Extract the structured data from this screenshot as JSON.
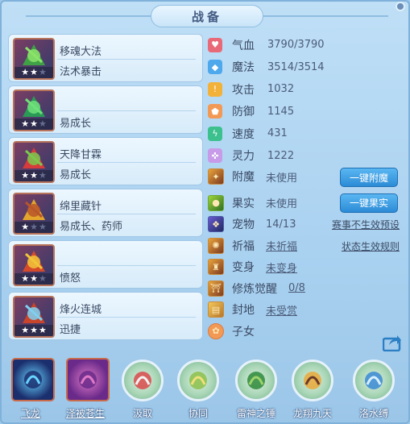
{
  "header": {
    "title": "战备"
  },
  "equipment": [
    {
      "name": "移魂大法",
      "effect": "法术暴击",
      "stars_filled": 2,
      "stars_total": 3,
      "colors": [
        "#3fa046",
        "#8be36a"
      ]
    },
    {
      "name": "",
      "effect": "易成长",
      "stars_filled": 2,
      "stars_total": 3,
      "colors": [
        "#2a9a56",
        "#6ee07a"
      ]
    },
    {
      "name": "天降甘霖",
      "effect": "易成长",
      "stars_filled": 2,
      "stars_total": 3,
      "colors": [
        "#d83b3b",
        "#7bc84e"
      ]
    },
    {
      "name": "绵里藏针",
      "effect": "易成长、药师",
      "stars_filled": 1,
      "stars_total": 3,
      "colors": [
        "#e3a52b",
        "#b8562a"
      ]
    },
    {
      "name": "",
      "effect": "愤怒",
      "stars_filled": 2,
      "stars_total": 3,
      "colors": [
        "#d44a2a",
        "#f1c43a"
      ]
    },
    {
      "name": "烽火连城",
      "effect": "迅捷",
      "stars_filled": 3,
      "stars_total": 3,
      "colors": [
        "#c8442a",
        "#7fd0f0"
      ]
    }
  ],
  "stats": [
    {
      "label": "气血",
      "value": "3790/3790",
      "icon": "heart-icon",
      "color": "#e86a78",
      "glyph": "♥"
    },
    {
      "label": "魔法",
      "value": "3514/3514",
      "icon": "mana-icon",
      "color": "#4ea8ec",
      "glyph": "◆"
    },
    {
      "label": "攻击",
      "value": "1032",
      "icon": "attack-icon",
      "color": "#f2b23a",
      "glyph": "!"
    },
    {
      "label": "防御",
      "value": "1145",
      "icon": "defense-icon",
      "color": "#f29a55",
      "glyph": "⬟"
    },
    {
      "label": "速度",
      "value": "431",
      "icon": "speed-icon",
      "color": "#3cc08e",
      "glyph": "ϟ"
    },
    {
      "label": "灵力",
      "value": "1222",
      "icon": "spirit-icon",
      "color": "#c79be8",
      "glyph": "✜"
    }
  ],
  "misc": {
    "enchant": {
      "label": "附魔",
      "value": "未使用",
      "button": "一键附魔"
    },
    "fruit": {
      "label": "果实",
      "value": "未使用",
      "button": "一键果实"
    },
    "pet": {
      "label": "宠物",
      "value": "14/13",
      "link": "赛事不生效预设"
    },
    "bless": {
      "label": "祈福",
      "value": "未祈福",
      "link": "状态生效规则"
    },
    "transform": {
      "label": "变身",
      "value": "未变身"
    },
    "cultivate": {
      "label": "修炼觉醒",
      "value": "0/8"
    },
    "fief": {
      "label": "封地",
      "value": "未受赏"
    },
    "children": {
      "label": "子女"
    }
  },
  "skills": [
    {
      "name": "飞龙",
      "style": "square",
      "colors": [
        "#1b2f6e",
        "#68d4ff"
      ]
    },
    {
      "name": "泽被苍生",
      "style": "square",
      "colors": [
        "#6a2a8a",
        "#e07ac8"
      ]
    },
    {
      "name": "汲取",
      "style": "ring",
      "colors": [
        "#d84a4a",
        "#f3f3f3"
      ]
    },
    {
      "name": "协同",
      "style": "ring",
      "colors": [
        "#8cc04a",
        "#f0e07a"
      ]
    },
    {
      "name": "雷神之锤",
      "style": "ring",
      "colors": [
        "#2e8a3a",
        "#9ed46a"
      ]
    },
    {
      "name": "龙翔九天",
      "style": "ring",
      "colors": [
        "#e9a83a",
        "#6a3a2a"
      ]
    },
    {
      "name": "洛水缚",
      "style": "ring",
      "colors": [
        "#3a8ad4",
        "#d8f0ff"
      ]
    }
  ],
  "share": {
    "icon": "share-icon"
  }
}
